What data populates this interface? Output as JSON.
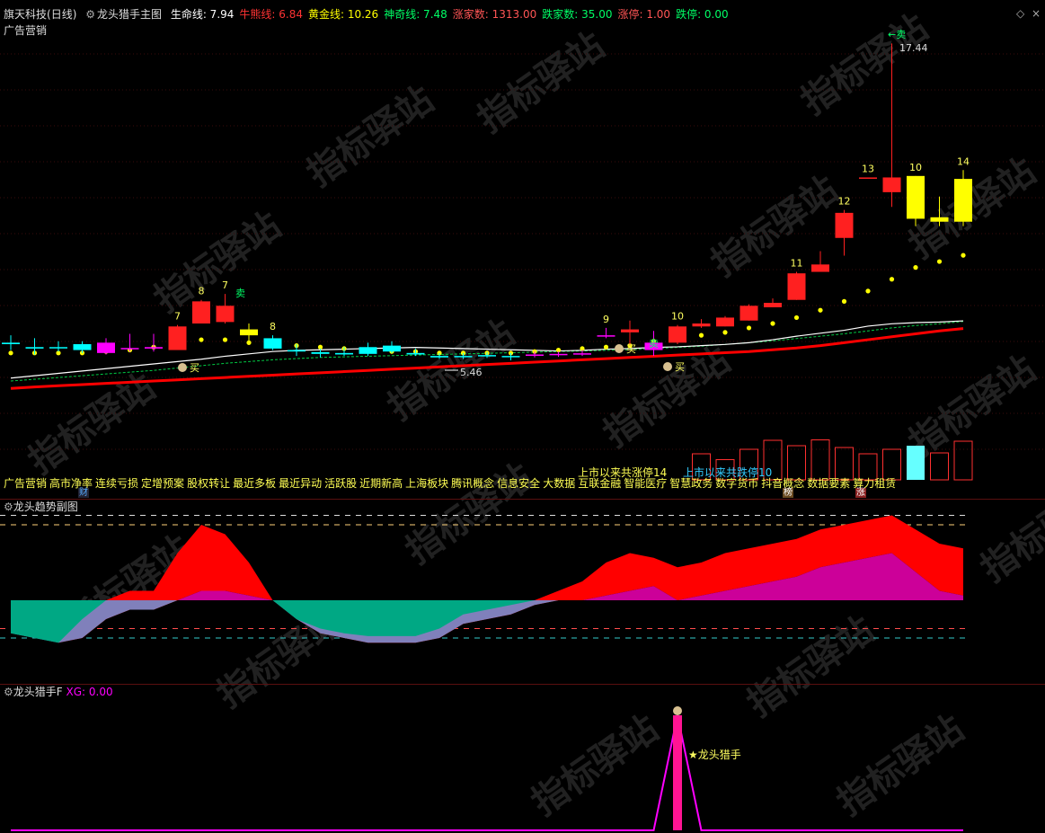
{
  "window": {
    "stock": "旗天科技",
    "period": "(日线)",
    "indicator": "龙头猎手主图",
    "ad_label": "广告营销",
    "toolbar_glyphs": [
      "\\/",
      "◇",
      "×"
    ]
  },
  "main_readouts": [
    {
      "label": "生命线:",
      "value": "7.94",
      "color": "#ffffff"
    },
    {
      "label": "牛熊线:",
      "value": "6.84",
      "color": "#ff3333"
    },
    {
      "label": "黄金线:",
      "value": "10.26",
      "color": "#ffff00"
    },
    {
      "label": "神奇线:",
      "value": "7.48",
      "color": "#00ff66"
    },
    {
      "label": "涨家数:",
      "value": "1313.00",
      "color": "#ff5555"
    },
    {
      "label": "跌家数:",
      "value": "35.00",
      "color": "#00ff66"
    },
    {
      "label": "涨停:",
      "value": "1.00",
      "color": "#ff5555"
    },
    {
      "label": "跌停:",
      "value": "0.00",
      "color": "#00ff66"
    }
  ],
  "concepts": [
    "广告营销",
    "高市净率",
    "连续亏损",
    "定增预案",
    "股权转让",
    "最近多板",
    "最近异动",
    "活跃股",
    "近期新高",
    "上海板块",
    "腾讯概念",
    "信息安全",
    "大数据",
    "互联金融",
    "智能医疗",
    "智慧政务",
    "数字货币",
    "抖音概念",
    "数据要素",
    "算力租赁"
  ],
  "badges": {
    "cai": "财",
    "bang": "榜",
    "zhang": "涨"
  },
  "volume_notes": {
    "up_limit_count": "上市以来共涨停14",
    "down_limit_count": "上市以来共跌停10"
  },
  "annotations": {
    "buy": "买",
    "sell": "卖",
    "sell_top": "←卖",
    "high": "17.44",
    "low": "5.46",
    "dragon_label": "★龙头猎手"
  },
  "sub1": {
    "title": "龙头趋势副图"
  },
  "sub2": {
    "title": "龙头猎手F",
    "readout_label": "XG:",
    "readout_value": "0.00"
  },
  "watermark": "指标驿站",
  "colors": {
    "up": "#ff2020",
    "down": "#00ffff",
    "doji_up": "#ffff00",
    "magenta": "#ff00ff",
    "life": "#ffffff",
    "bull_bear": "#ff0000",
    "gold_dots": "#ffff00",
    "magic": "#00cc44",
    "cyan_fill": "#00a884",
    "red_fill": "#ff0000",
    "mag_fill": "#cc0099",
    "lav_fill": "#8080bb",
    "pink": "#ff1493"
  },
  "chart_data": {
    "type": "candlestick",
    "price_range": [
      4.6,
      18.0
    ],
    "candles": [
      {
        "o": 7.3,
        "h": 7.55,
        "l": 7.05,
        "c": 7.25,
        "col": "cyan"
      },
      {
        "o": 7.15,
        "h": 7.45,
        "l": 6.9,
        "c": 7.1,
        "col": "cyan"
      },
      {
        "o": 7.15,
        "h": 7.35,
        "l": 7.0,
        "c": 7.12,
        "col": "cyan"
      },
      {
        "o": 7.25,
        "h": 7.35,
        "l": 6.95,
        "c": 7.05,
        "col": "cyan"
      },
      {
        "o": 7.3,
        "h": 7.45,
        "l": 6.9,
        "c": 6.95,
        "col": "magenta"
      },
      {
        "o": 7.12,
        "h": 7.6,
        "l": 7.0,
        "c": 7.1,
        "col": "magenta"
      },
      {
        "o": 7.15,
        "h": 7.6,
        "l": 7.0,
        "c": 7.1,
        "col": "magenta"
      },
      {
        "o": 7.05,
        "h": 7.9,
        "l": 7.05,
        "c": 7.85,
        "col": "red",
        "num": "7"
      },
      {
        "o": 7.95,
        "h": 8.75,
        "l": 7.95,
        "c": 8.7,
        "col": "red",
        "num": "8"
      },
      {
        "o": 8.55,
        "h": 8.95,
        "l": 7.95,
        "c": 8.0,
        "col": "red",
        "num": "7"
      },
      {
        "o": 7.75,
        "h": 7.95,
        "l": 7.3,
        "c": 7.55,
        "col": "yellow"
      },
      {
        "o": 7.45,
        "h": 7.55,
        "l": 7.05,
        "c": 7.1,
        "col": "cyan",
        "num": "8"
      },
      {
        "o": 7.05,
        "h": 7.25,
        "l": 6.85,
        "c": 7.0,
        "col": "cyan"
      },
      {
        "o": 6.98,
        "h": 7.1,
        "l": 6.8,
        "c": 6.92,
        "col": "cyan"
      },
      {
        "o": 6.95,
        "h": 7.15,
        "l": 6.85,
        "c": 6.9,
        "col": "cyan"
      },
      {
        "o": 7.15,
        "h": 7.3,
        "l": 6.85,
        "c": 6.92,
        "col": "cyan"
      },
      {
        "o": 7.2,
        "h": 7.35,
        "l": 6.95,
        "c": 7.0,
        "col": "cyan"
      },
      {
        "o": 6.95,
        "h": 7.1,
        "l": 6.85,
        "c": 6.9,
        "col": "cyan"
      },
      {
        "o": 6.85,
        "h": 6.95,
        "l": 6.75,
        "c": 6.8,
        "col": "cyan"
      },
      {
        "o": 6.85,
        "h": 6.95,
        "l": 6.75,
        "c": 6.82,
        "col": "cyan"
      },
      {
        "o": 6.88,
        "h": 6.98,
        "l": 6.78,
        "c": 6.84,
        "col": "cyan"
      },
      {
        "o": 6.85,
        "h": 6.95,
        "l": 6.7,
        "c": 6.82,
        "col": "cyan"
      },
      {
        "o": 6.9,
        "h": 7.0,
        "l": 6.8,
        "c": 6.86,
        "col": "magenta"
      },
      {
        "o": 6.92,
        "h": 7.0,
        "l": 6.82,
        "c": 6.9,
        "col": "magenta"
      },
      {
        "o": 6.94,
        "h": 7.05,
        "l": 6.85,
        "c": 6.92,
        "col": "magenta"
      },
      {
        "o": 7.55,
        "h": 7.8,
        "l": 7.45,
        "c": 7.52,
        "col": "magenta",
        "num": "9"
      },
      {
        "o": 7.65,
        "h": 8.05,
        "l": 7.2,
        "c": 7.75,
        "col": "red"
      },
      {
        "o": 7.3,
        "h": 7.7,
        "l": 6.85,
        "c": 7.05,
        "col": "magenta"
      },
      {
        "o": 7.3,
        "h": 7.9,
        "l": 7.25,
        "c": 7.85,
        "col": "red",
        "num": "10"
      },
      {
        "o": 7.85,
        "h": 8.1,
        "l": 7.8,
        "c": 7.95,
        "col": "red"
      },
      {
        "o": 7.85,
        "h": 8.2,
        "l": 7.85,
        "c": 8.15,
        "col": "red"
      },
      {
        "o": 8.05,
        "h": 8.6,
        "l": 8.05,
        "c": 8.55,
        "col": "red"
      },
      {
        "o": 8.5,
        "h": 8.8,
        "l": 8.5,
        "c": 8.65,
        "col": "red"
      },
      {
        "o": 8.75,
        "h": 9.7,
        "l": 8.75,
        "c": 9.65,
        "col": "red",
        "num": "11"
      },
      {
        "o": 9.7,
        "h": 10.4,
        "l": 9.7,
        "c": 9.95,
        "col": "red"
      },
      {
        "o": 10.85,
        "h": 11.8,
        "l": 10.25,
        "c": 11.7,
        "col": "red",
        "num": "12"
      },
      {
        "o": 12.9,
        "h": 12.9,
        "l": 12.9,
        "c": 12.9,
        "col": "red",
        "num": "13"
      },
      {
        "o": 12.4,
        "h": 17.44,
        "l": 11.9,
        "c": 12.9,
        "col": "red"
      },
      {
        "o": 12.95,
        "h": 12.95,
        "l": 11.25,
        "c": 11.5,
        "col": "yellow",
        "num": "10"
      },
      {
        "o": 11.55,
        "h": 12.25,
        "l": 11.25,
        "c": 11.4,
        "col": "yellow"
      },
      {
        "o": 12.85,
        "h": 13.15,
        "l": 11.25,
        "c": 11.4,
        "col": "yellow",
        "num": "14"
      }
    ],
    "life_line": [
      6.1,
      6.18,
      6.26,
      6.34,
      6.42,
      6.5,
      6.58,
      6.66,
      6.74,
      6.84,
      6.92,
      7.0,
      7.04,
      7.06,
      7.08,
      7.1,
      7.12,
      7.14,
      7.12,
      7.1,
      7.08,
      7.06,
      7.04,
      7.02,
      7.04,
      7.08,
      7.1,
      7.14,
      7.16,
      7.2,
      7.24,
      7.3,
      7.4,
      7.52,
      7.62,
      7.72,
      7.86,
      7.94,
      7.98,
      8.0,
      8.04
    ],
    "magic_line": [
      6.0,
      6.06,
      6.12,
      6.18,
      6.24,
      6.3,
      6.36,
      6.44,
      6.52,
      6.6,
      6.66,
      6.72,
      6.76,
      6.8,
      6.82,
      6.84,
      6.86,
      6.88,
      6.9,
      6.92,
      6.94,
      6.96,
      6.98,
      7.0,
      7.02,
      7.04,
      7.06,
      7.1,
      7.14,
      7.18,
      7.24,
      7.3,
      7.36,
      7.44,
      7.52,
      7.6,
      7.7,
      7.8,
      7.88,
      7.94,
      8.02
    ],
    "bull_bear_line": [
      5.75,
      5.8,
      5.84,
      5.88,
      5.92,
      5.96,
      6.0,
      6.04,
      6.08,
      6.12,
      6.16,
      6.2,
      6.24,
      6.28,
      6.32,
      6.36,
      6.4,
      6.44,
      6.48,
      6.52,
      6.56,
      6.6,
      6.64,
      6.68,
      6.72,
      6.76,
      6.8,
      6.84,
      6.88,
      6.92,
      6.96,
      7.0,
      7.06,
      7.12,
      7.2,
      7.3,
      7.4,
      7.5,
      7.6,
      7.7,
      7.78
    ],
    "gold_dots": [
      6.95,
      6.95,
      6.95,
      6.95,
      7.0,
      7.05,
      7.15,
      7.35,
      7.4,
      7.4,
      7.3,
      7.25,
      7.2,
      7.15,
      7.1,
      7.05,
      7.0,
      7.0,
      6.95,
      6.95,
      6.95,
      6.95,
      7.0,
      7.05,
      7.1,
      7.15,
      7.2,
      7.35,
      7.45,
      7.55,
      7.65,
      7.8,
      7.95,
      8.15,
      8.4,
      8.7,
      9.05,
      9.45,
      9.85,
      10.05,
      10.26
    ],
    "volume": [
      null,
      null,
      null,
      null,
      null,
      null,
      null,
      null,
      null,
      null,
      null,
      null,
      null,
      null,
      null,
      null,
      null,
      null,
      null,
      null,
      null,
      null,
      null,
      null,
      null,
      null,
      null,
      null,
      null,
      0.58,
      0.45,
      0.68,
      0.88,
      0.76,
      0.89,
      0.72,
      0.58,
      0.68,
      0.76,
      0.6,
      0.86
    ],
    "volume_color": [
      null,
      null,
      null,
      null,
      null,
      null,
      null,
      null,
      null,
      null,
      null,
      null,
      null,
      null,
      null,
      null,
      null,
      null,
      null,
      null,
      null,
      null,
      null,
      null,
      null,
      null,
      null,
      null,
      null,
      "red",
      "red",
      "red",
      "red",
      "red",
      "red",
      "red",
      "red",
      "red",
      "cyan",
      "red",
      "red"
    ],
    "sub1_thresholds": [
      90,
      80,
      -30,
      -40
    ],
    "sub1_upper": [
      -35,
      -40,
      -45,
      -20,
      0,
      10,
      10,
      50,
      80,
      70,
      40,
      0,
      -20,
      -30,
      -35,
      -38,
      -38,
      -38,
      -30,
      -15,
      -10,
      -5,
      0,
      10,
      20,
      40,
      50,
      45,
      35,
      40,
      50,
      55,
      60,
      65,
      75,
      80,
      85,
      90,
      75,
      60,
      55
    ],
    "sub1_lower": [
      -35,
      -40,
      -45,
      -40,
      -20,
      -10,
      -10,
      0,
      10,
      10,
      5,
      0,
      -20,
      -35,
      -40,
      -45,
      -45,
      -45,
      -40,
      -25,
      -20,
      -15,
      -5,
      0,
      0,
      5,
      10,
      15,
      0,
      5,
      10,
      15,
      20,
      25,
      35,
      40,
      45,
      50,
      30,
      10,
      5
    ],
    "sub2_signal": [
      0,
      0,
      0,
      0,
      0,
      0,
      0,
      0,
      0,
      0,
      0,
      0,
      0,
      0,
      0,
      0,
      0,
      0,
      0,
      0,
      0,
      0,
      0,
      0,
      0,
      0,
      0,
      0,
      1,
      0,
      0,
      0,
      0,
      0,
      0,
      0,
      0,
      0,
      0,
      0,
      0
    ]
  }
}
